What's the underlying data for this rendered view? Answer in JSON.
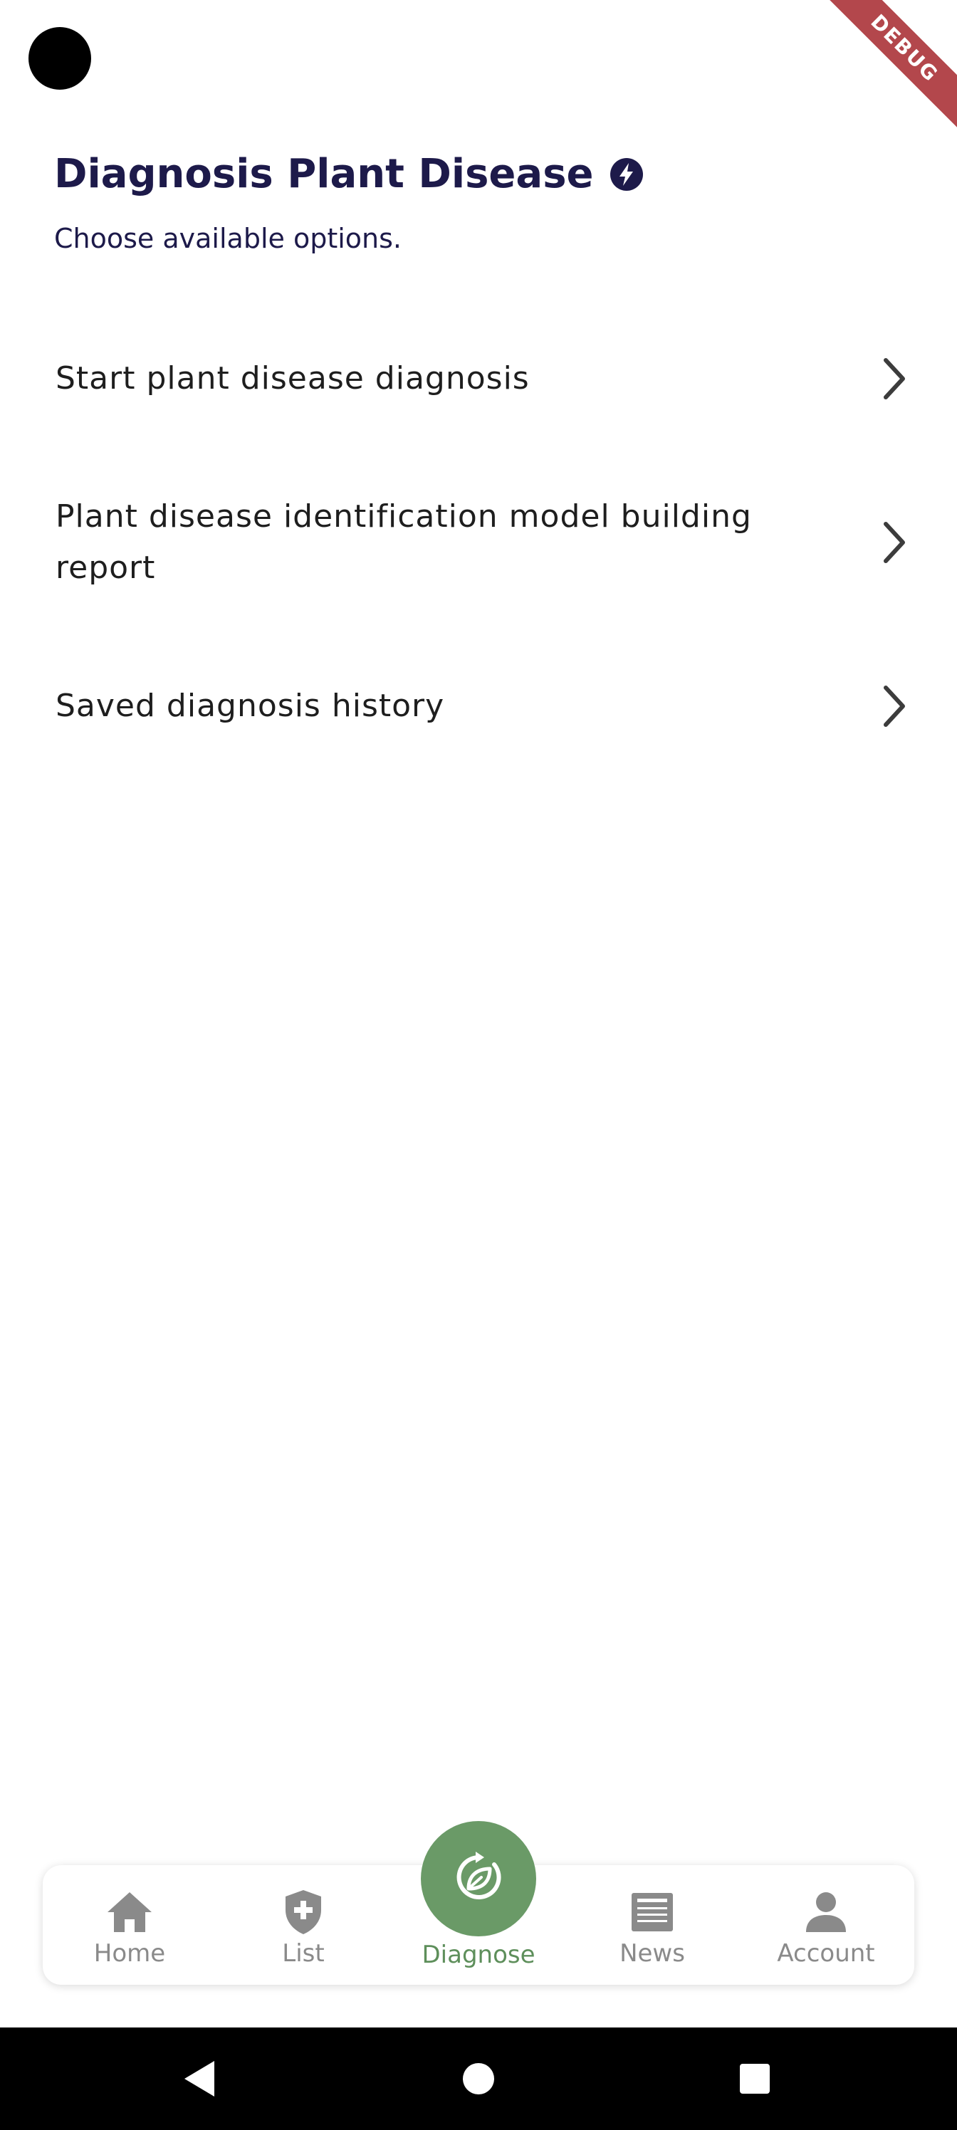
{
  "header": {
    "title": "Diagnosis Plant Disease",
    "subtitle": "Choose available options."
  },
  "debug_banner": "DEBUG",
  "options": [
    {
      "label": "Start plant disease diagnosis"
    },
    {
      "label": "Plant disease identification model building report"
    },
    {
      "label": "Saved diagnosis history"
    }
  ],
  "bottom_nav": {
    "items": [
      {
        "label": "Home",
        "icon": "home-icon"
      },
      {
        "label": "List",
        "icon": "shield-plus-icon"
      },
      {
        "label": "Diagnose",
        "icon": "diagnose-leaf-icon",
        "active": true
      },
      {
        "label": "News",
        "icon": "newspaper-icon"
      },
      {
        "label": "Account",
        "icon": "person-icon"
      }
    ]
  },
  "colors": {
    "title": "#1d1a4a",
    "accent": "#6a9a67",
    "inactive": "#8a8a8a"
  }
}
